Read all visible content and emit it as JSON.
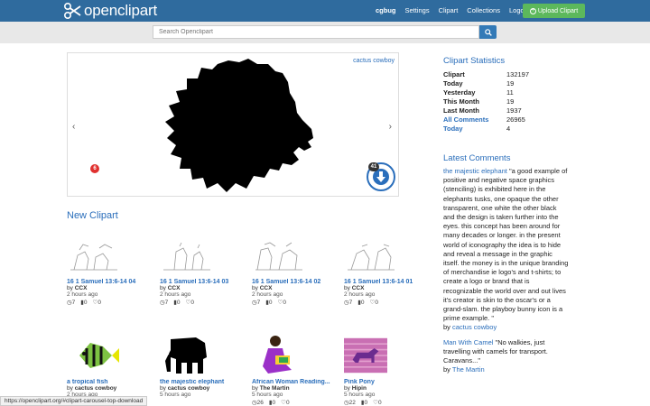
{
  "nav": {
    "logo_text": "openclipart",
    "links": [
      "cgbug",
      "Settings",
      "Clipart",
      "Collections",
      "Logout"
    ],
    "upload_label": "Upload Clipart"
  },
  "search": {
    "placeholder": "Search Openclipart"
  },
  "carousel": {
    "author": "cactus cowboy",
    "badge": "6",
    "download_count": "41"
  },
  "new_clipart": {
    "title": "New Clipart",
    "items": [
      {
        "title": "16 1 Samuel 13:6-14 04",
        "by_prefix": "by",
        "author": "CCX",
        "time": "2 hours ago",
        "views": "7",
        "comments": "0",
        "likes": "0"
      },
      {
        "title": "16 1 Samuel 13:6-14 03",
        "by_prefix": "by",
        "author": "CCX",
        "time": "2 hours ago",
        "views": "7",
        "comments": "0",
        "likes": "0"
      },
      {
        "title": "16 1 Samuel 13:6-14 02",
        "by_prefix": "by",
        "author": "CCX",
        "time": "2 hours ago",
        "views": "7",
        "comments": "0",
        "likes": "0"
      },
      {
        "title": "16 1 Samuel 13:6-14 01",
        "by_prefix": "by",
        "author": "CCX",
        "time": "2 hours ago",
        "views": "7",
        "comments": "0",
        "likes": "0"
      },
      {
        "title": "a tropical fish",
        "by_prefix": "by",
        "author": "cactus cowboy",
        "time": "2 hours ago"
      },
      {
        "title": "the majestic elephant",
        "by_prefix": "by",
        "author": "cactus cowboy",
        "time": "5 hours ago"
      },
      {
        "title": "African Woman Reading...",
        "by_prefix": "by",
        "author": "The Martin",
        "time": "5 hours ago",
        "views": "26",
        "comments": "0",
        "likes": "0"
      },
      {
        "title": "Pink Pony",
        "by_prefix": "by",
        "author": "Hipin",
        "time": "5 hours ago",
        "views": "22",
        "comments": "0",
        "likes": "0"
      }
    ]
  },
  "stats": {
    "title": "Clipart Statistics",
    "rows": [
      {
        "label": "Clipart",
        "value": "132197"
      },
      {
        "label": "Today",
        "value": "19"
      },
      {
        "label": "Yesterday",
        "value": "11"
      },
      {
        "label": "This Month",
        "value": "19"
      },
      {
        "label": "Last Month",
        "value": "1937"
      },
      {
        "label": "All Comments",
        "value": "26965"
      },
      {
        "label": "Today",
        "value": "4"
      }
    ]
  },
  "comments": {
    "title": "Latest Comments",
    "items": [
      {
        "subject": "the majestic elephant",
        "text": "\"a good example of positive and negative space graphics (stenciling) is exhibited here in the elephants tusks, one opaque the other transparent, one white the other black and the design is taken further into the eyes. this concept has been around for many decades or longer. in the present world of iconography the idea is to hide and reveal a message in the graphic itself. the money is in the unique branding of merchandise ie logo's and t-shirts; to create a logo or brand that is recognizable the world over and out lives it's creator is skin to the oscar's or a grand-slam. the playboy bunny icon is a prime example. \"",
        "by_prefix": "by",
        "author": "cactus cowboy"
      },
      {
        "subject": "Man With Camel",
        "text": "\"No walkies, just travelling with camels for transport. Caravans...\"",
        "by_prefix": "by",
        "author": "The Martin"
      }
    ]
  },
  "status_url": "https://openclipart.org/#clipart-carousel-top-download",
  "colors": {
    "navbar": "#2f6b9e",
    "link": "#2a6ebb",
    "upload": "#5cb85c"
  }
}
